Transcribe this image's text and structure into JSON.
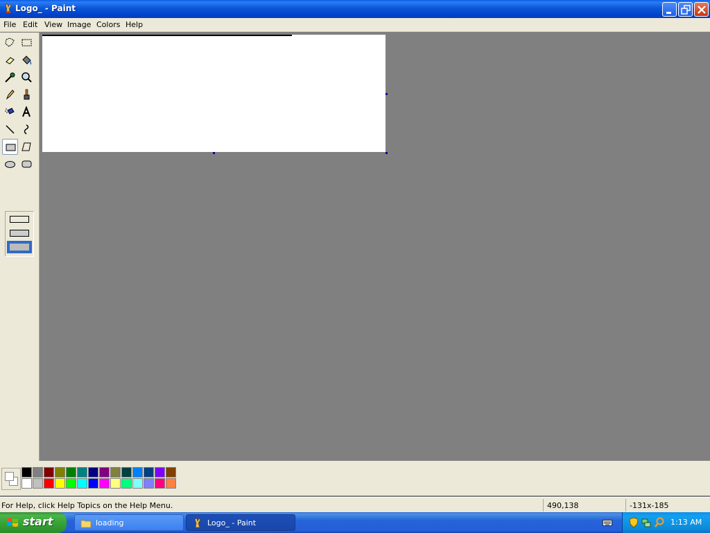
{
  "window": {
    "title": "Logo_ - Paint",
    "minimize_icon": "minimize-icon",
    "maximize_icon": "restore-icon",
    "close_icon": "close-icon"
  },
  "menu": [
    "File",
    "Edit",
    "View",
    "Image",
    "Colors",
    "Help"
  ],
  "tools": [
    {
      "name": "free-form-select"
    },
    {
      "name": "select"
    },
    {
      "name": "eraser"
    },
    {
      "name": "fill-with-color"
    },
    {
      "name": "pick-color"
    },
    {
      "name": "magnifier"
    },
    {
      "name": "pencil"
    },
    {
      "name": "brush"
    },
    {
      "name": "airbrush"
    },
    {
      "name": "text"
    },
    {
      "name": "line"
    },
    {
      "name": "curve"
    },
    {
      "name": "rectangle",
      "selected": true
    },
    {
      "name": "polygon"
    },
    {
      "name": "ellipse"
    },
    {
      "name": "rounded-rectangle"
    }
  ],
  "fill_styles": [
    "outline",
    "outline-with-fill",
    "fill-only"
  ],
  "fill_style_selected": "fill-only",
  "palette": {
    "foreground": "#ffffff",
    "background": "#ffffff",
    "row1": [
      "#000000",
      "#808080",
      "#800000",
      "#808000",
      "#008000",
      "#008080",
      "#000080",
      "#800080",
      "#808040",
      "#004040",
      "#0080ff",
      "#004080",
      "#8000ff",
      "#804000"
    ],
    "row2": [
      "#ffffff",
      "#c0c0c0",
      "#ff0000",
      "#ffff00",
      "#00ff00",
      "#00ffff",
      "#0000ff",
      "#ff00ff",
      "#ffff80",
      "#00ff80",
      "#80ffff",
      "#8080ff",
      "#ff0080",
      "#ff8040"
    ]
  },
  "status": {
    "help": "For Help, click Help Topics on the Help Menu.",
    "cursor_pos": "490,138",
    "selection_size": "-131x-185"
  },
  "taskbar": {
    "start_label": "start",
    "tasks": [
      {
        "label": "loading",
        "icon": "folder-icon",
        "active": false
      },
      {
        "label": "Logo_ - Paint",
        "icon": "paint-icon",
        "active": true
      }
    ],
    "clock": "1:13 AM"
  }
}
